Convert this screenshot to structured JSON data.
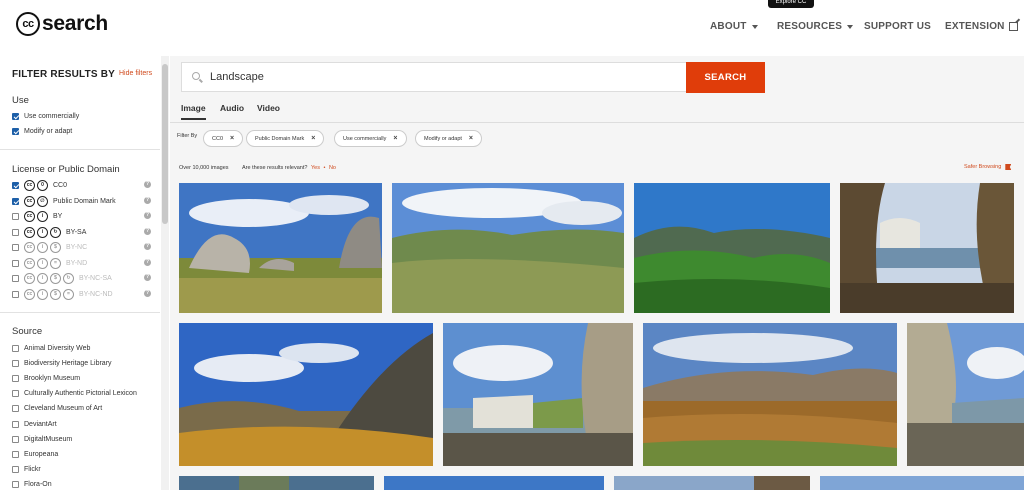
{
  "header": {
    "logo_text": "search",
    "tooltip": "Explore CC",
    "nav": [
      {
        "label": "ABOUT"
      },
      {
        "label": "RESOURCES"
      },
      {
        "label": "SUPPORT US"
      },
      {
        "label": "EXTENSION"
      }
    ]
  },
  "sidebar": {
    "title": "FILTER RESULTS BY",
    "hide_filters": "Hide filters",
    "use": {
      "title": "Use",
      "options": [
        {
          "label": "Use commercially",
          "checked": true
        },
        {
          "label": "Modify or adapt",
          "checked": true
        }
      ]
    },
    "license": {
      "title": "License or Public Domain",
      "options": [
        {
          "label": "CC0",
          "checked": true,
          "icons": [
            "cc",
            "zero"
          ],
          "disabled": false
        },
        {
          "label": "Public Domain Mark",
          "checked": true,
          "icons": [
            "cc",
            "pd"
          ],
          "disabled": false
        },
        {
          "label": "BY",
          "checked": false,
          "icons": [
            "cc",
            "by"
          ],
          "disabled": false
        },
        {
          "label": "BY-SA",
          "checked": false,
          "icons": [
            "cc",
            "by",
            "sa"
          ],
          "disabled": false
        },
        {
          "label": "BY-NC",
          "checked": false,
          "icons": [
            "cc",
            "by",
            "nc"
          ],
          "disabled": true
        },
        {
          "label": "BY-ND",
          "checked": false,
          "icons": [
            "cc",
            "by",
            "nd"
          ],
          "disabled": true
        },
        {
          "label": "BY-NC-SA",
          "checked": false,
          "icons": [
            "cc",
            "by",
            "nc",
            "sa"
          ],
          "disabled": true
        },
        {
          "label": "BY-NC-ND",
          "checked": false,
          "icons": [
            "cc",
            "by",
            "nc",
            "nd"
          ],
          "disabled": true
        }
      ]
    },
    "source": {
      "title": "Source",
      "options": [
        {
          "label": "Animal Diversity Web"
        },
        {
          "label": "Biodiversity Heritage Library"
        },
        {
          "label": "Brooklyn Museum"
        },
        {
          "label": "Culturally Authentic Pictorial Lexicon"
        },
        {
          "label": "Cleveland Museum of Art"
        },
        {
          "label": "DeviantArt"
        },
        {
          "label": "DigitaltMuseum"
        },
        {
          "label": "Europeana"
        },
        {
          "label": "Flickr"
        },
        {
          "label": "Flora-On"
        }
      ]
    }
  },
  "search": {
    "query": "Landscape",
    "button_label": "SEARCH"
  },
  "tabs": [
    {
      "label": "Image",
      "active": true
    },
    {
      "label": "Audio",
      "active": false
    },
    {
      "label": "Video",
      "active": false
    }
  ],
  "filters": {
    "label": "Filter By",
    "chips": [
      {
        "label": "CC0"
      },
      {
        "label": "Public Domain Mark"
      },
      {
        "label": "Use commercially"
      },
      {
        "label": "Modify or adapt"
      }
    ]
  },
  "results": {
    "count": "Over 10,000 images",
    "relevance_question": "Are these results relevant?",
    "yes": "Yes",
    "separator": "•",
    "no": "No",
    "safer_browsing": "Safer Browsing"
  },
  "colors": {
    "accent": "#e03d0a",
    "link": "#d04a1d",
    "checkbox": "#1d5fa8"
  }
}
